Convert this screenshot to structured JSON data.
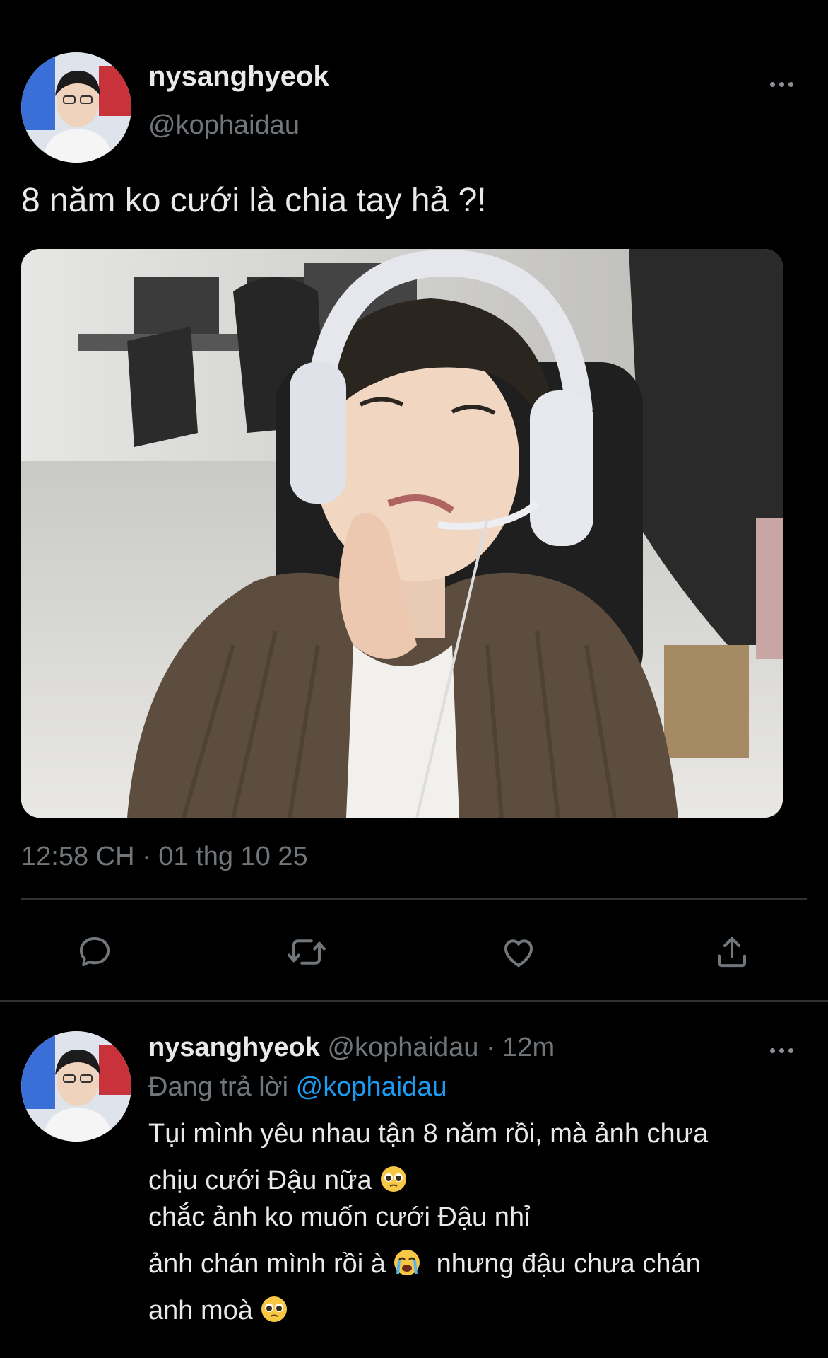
{
  "main_tweet": {
    "display_name": "nysanghyeok",
    "handle": "@kophaidau",
    "text": "8 năm ko cưới là chia tay hả ?!",
    "timestamp": "12:58 CH · 01 thg 10 25",
    "more_icon": "more-horizontal-icon"
  },
  "actions": {
    "icons": [
      "reply-icon",
      "retweet-icon",
      "like-icon",
      "share-icon"
    ]
  },
  "reply": {
    "display_name": "nysanghyeok",
    "handle": "@kophaidau",
    "time": "· 12m",
    "replying_prefix": "Đang trả lời",
    "replying_handle": "@kophaidau",
    "lines": [
      "Tụi mình yêu nhau tận 8 năm rồi, mà ảnh chưa",
      "chịu cưới Đậu nữa",
      "chắc ảnh ko muốn cưới Đậu nhỉ",
      "ảnh chán mình rồi à",
      "nhưng đậu chưa chán",
      "anh moà"
    ]
  },
  "colors": {
    "background": "#000000",
    "text": "#e7e9ea",
    "muted": "#71767b",
    "accent": "#1d9bf0",
    "divider": "#2f3336"
  }
}
